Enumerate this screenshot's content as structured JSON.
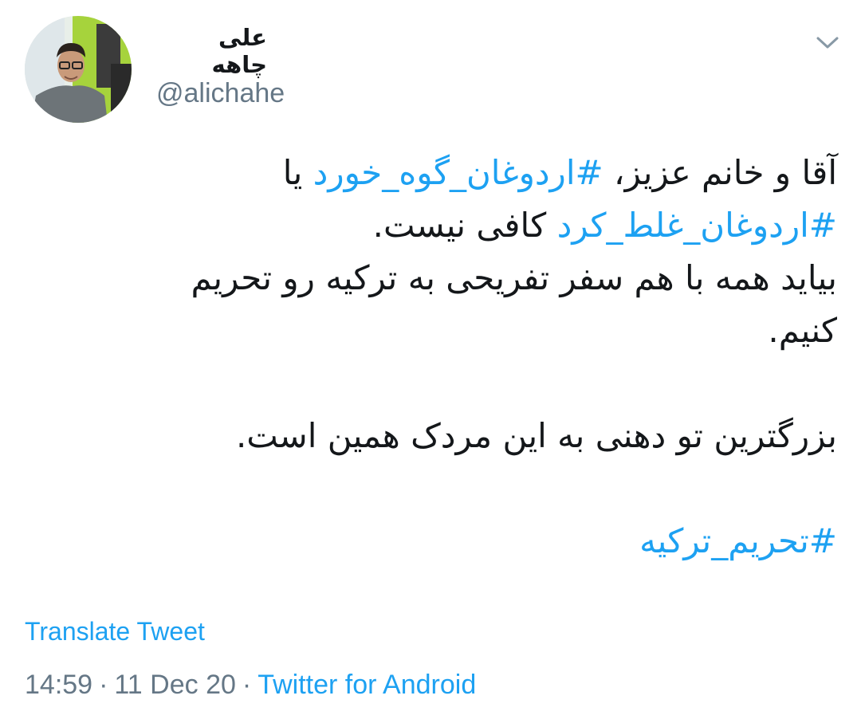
{
  "author": {
    "display_name": "علی چاهه",
    "handle": "@alichahe",
    "avatar_icon": "user-photo-avatar"
  },
  "menu_icon": "chevron-down-icon",
  "tweet": {
    "line1_text": "آقا و خانم عزیز، ",
    "line1_hashtag": "#اردوغان_گوه_خورد",
    "line1_tail": " یا",
    "line2_hashtag": "#اردوغان_غلط_کرد",
    "line2_tail": " کافی نیست.",
    "line3": "بیاید همه با هم سفر تفریحی به ترکیه رو تحریم",
    "line4": "کنیم.",
    "line5": "بزرگترین تو دهنی به این مردک همین است.",
    "hashtag_final": "#تحریم_ترکیه"
  },
  "translate_label": "Translate Tweet",
  "meta": {
    "time": "14:59",
    "separator": "·",
    "date": "11 Dec 20",
    "source": "Twitter for Android"
  },
  "colors": {
    "link": "#1da1f2",
    "secondary_text": "#657786",
    "primary_text": "#14171a"
  }
}
